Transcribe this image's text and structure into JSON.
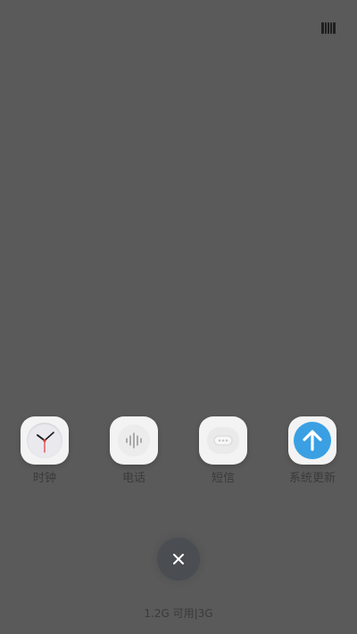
{
  "status": {
    "icon": "signal-bars-icon"
  },
  "apps": [
    {
      "label": "时钟",
      "icon": "clock-icon"
    },
    {
      "label": "电话",
      "icon": "phone-icon"
    },
    {
      "label": "短信",
      "icon": "message-icon"
    },
    {
      "label": "系统更新",
      "icon": "system-update-icon"
    }
  ],
  "close": {
    "icon": "close-icon"
  },
  "memory": {
    "text": "1.2G 可用|3G"
  },
  "colors": {
    "background": "#5a5a5a",
    "update_blue": "#3aa0e3",
    "clock_second_hand": "#d93636"
  }
}
